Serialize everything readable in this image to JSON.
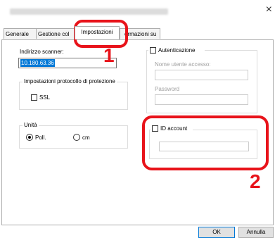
{
  "window": {
    "close_glyph": "×"
  },
  "tabs": [
    {
      "label": "Generale"
    },
    {
      "label": "Gestione col"
    },
    {
      "label": "Impostazioni"
    },
    {
      "label": "ormazioni su"
    }
  ],
  "scanner": {
    "label": "Indirizzo scanner:",
    "value": "10.180.63.36"
  },
  "protocol": {
    "title": "Impostazioni protocollo di protezione",
    "ssl_label": "SSL",
    "ssl_checked": false
  },
  "units": {
    "title": "Unità",
    "options": [
      "Poll.",
      "cm"
    ],
    "selected": "Poll."
  },
  "auth": {
    "label": "Autenticazione",
    "checked": false,
    "username_label": "Nome utente accesso:",
    "username_value": "",
    "password_label": "Password",
    "password_value": ""
  },
  "account": {
    "label": "ID account",
    "checked": false,
    "value": ""
  },
  "callouts": {
    "step1": "1",
    "step2": "2",
    "color": "#e8131a"
  },
  "buttons": {
    "ok": "OK",
    "cancel": "Annulla"
  }
}
